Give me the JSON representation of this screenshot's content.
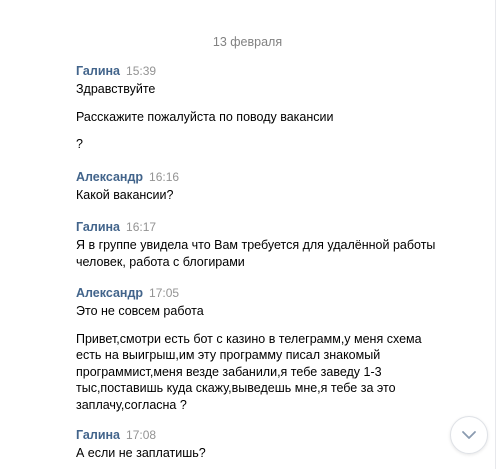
{
  "date_separator": "13 февраля",
  "messages": [
    {
      "author": "Галина",
      "time": "15:39",
      "paragraphs": [
        [
          "Здравствуйте"
        ],
        [
          "Расскажите пожалуйста по поводу вакансии"
        ],
        [
          "?"
        ]
      ]
    },
    {
      "author": "Александр",
      "time": "16:16",
      "paragraphs": [
        [
          "Какой вакансии?"
        ]
      ]
    },
    {
      "author": "Галина",
      "time": "16:17",
      "paragraphs": [
        [
          "Я в группе увидела что Вам требуется для удалённой работы",
          "человек, работа с блогирами"
        ]
      ]
    },
    {
      "author": "Александр",
      "time": "17:05",
      "paragraphs": [
        [
          "Это не совсем работа"
        ],
        [
          "Привет,смотри есть бот с казино в телеграмм,у меня схема",
          "есть на выигрыш,им эту программу писал знакомый",
          "программист,меня везде забанили,я тебе заведу 1-3",
          "тыс,поставишь куда скажу,выведешь мне,я тебе за это",
          "заплачу,согласна ?"
        ]
      ]
    },
    {
      "author": "Галина",
      "time": "17:08",
      "paragraphs": [
        [
          "А если не заплатишь?"
        ]
      ]
    }
  ],
  "scroll_button": {
    "icon": "chevron-down-icon"
  },
  "colors": {
    "author": "#42648b",
    "time": "#939393",
    "date": "#828282",
    "text": "#000000"
  }
}
